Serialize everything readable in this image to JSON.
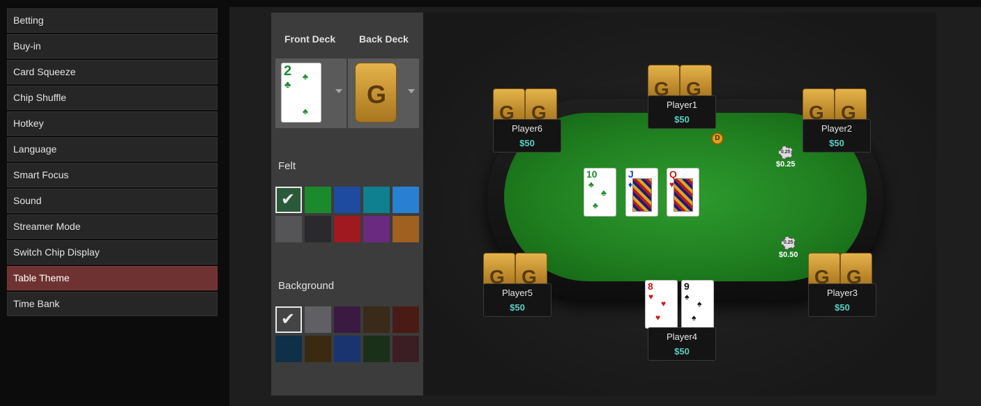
{
  "sidebar": {
    "items": [
      {
        "label": "Betting"
      },
      {
        "label": "Buy-in"
      },
      {
        "label": "Card Squeeze"
      },
      {
        "label": "Chip Shuffle"
      },
      {
        "label": "Hotkey"
      },
      {
        "label": "Language"
      },
      {
        "label": "Smart Focus"
      },
      {
        "label": "Sound"
      },
      {
        "label": "Streamer Mode"
      },
      {
        "label": "Switch Chip Display"
      },
      {
        "label": "Table Theme"
      },
      {
        "label": "Time Bank"
      }
    ],
    "active": "Table Theme"
  },
  "settings": {
    "front_deck_label": "Front Deck",
    "back_deck_label": "Back Deck",
    "front_deck_preview": {
      "rank": "2",
      "suit": "♣"
    },
    "back_deck_preview": {
      "logo": "G"
    },
    "felt_label": "Felt",
    "felt_colors": [
      "#2a5a3a",
      "#1b8a2c",
      "#1e4aa0",
      "#0e8090",
      "#2a80d0",
      "#555558",
      "#2a2a2c",
      "#a01820",
      "#6a2a80",
      "#a06020"
    ],
    "felt_selected": 0,
    "background_label": "Background",
    "background_colors": [
      "#444444",
      "#606064",
      "#3a1a40",
      "#3a2a1a",
      "#4a1a14",
      "#0e3048",
      "#3a2a10",
      "#1a3470",
      "#1a3018",
      "#3a1e24"
    ],
    "background_selected": 0
  },
  "table": {
    "community_cards": [
      {
        "rank": "10",
        "suit": "♣",
        "color": "grn"
      },
      {
        "rank": "J",
        "suit": "♦",
        "color": "blu"
      },
      {
        "rank": "Q",
        "suit": "♥",
        "color": "red"
      }
    ],
    "hero_cards": [
      {
        "rank": "8",
        "suit": "♥",
        "color": "red"
      },
      {
        "rank": "9",
        "suit": "♠",
        "color": "blk"
      }
    ],
    "dealer_button": "D",
    "bets": [
      {
        "chip": "0.25",
        "amount": "$0.25"
      },
      {
        "chip": "0.25",
        "amount": "$0.50"
      }
    ],
    "players": [
      {
        "name": "Player1",
        "stack": "$50"
      },
      {
        "name": "Player2",
        "stack": "$50"
      },
      {
        "name": "Player3",
        "stack": "$50"
      },
      {
        "name": "Player4",
        "stack": "$50"
      },
      {
        "name": "Player5",
        "stack": "$50"
      },
      {
        "name": "Player6",
        "stack": "$50"
      }
    ],
    "card_back_logo": "G"
  }
}
